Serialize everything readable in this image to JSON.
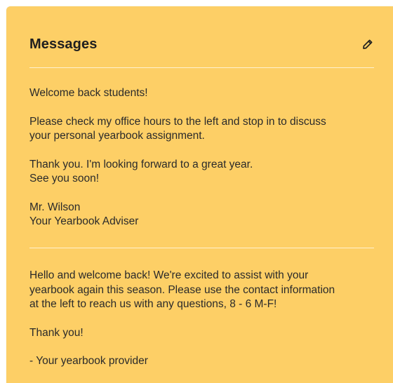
{
  "panel": {
    "title": "Messages",
    "edit_icon": "pencil-icon",
    "background_color": "#FDCF66"
  },
  "messages": [
    {
      "paragraphs": [
        [
          "Welcome back students!"
        ],
        [
          "Please check my office hours to the left and stop in to discuss",
          "your personal yearbook assignment."
        ],
        [
          "Thank you. I'm looking forward to a great year.",
          "See you soon!"
        ],
        [
          "Mr. Wilson",
          "Your Yearbook Adviser"
        ]
      ]
    },
    {
      "paragraphs": [
        [
          "Hello and welcome back! We're excited to assist with your",
          "yearbook again this season. Please use the contact information",
          "at the left to reach us with any questions, 8 - 6 M-F!"
        ],
        [
          "Thank you!"
        ],
        [
          "- Your yearbook provider"
        ]
      ]
    }
  ]
}
